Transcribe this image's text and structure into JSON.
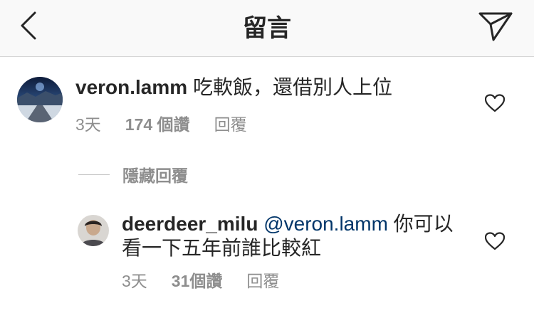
{
  "header": {
    "title": "留言",
    "back_icon": "chevron-left-icon",
    "send_icon": "paper-plane-icon"
  },
  "comments": [
    {
      "username": "veron.lamm",
      "text": "吃軟飯，還借別人上位",
      "time": "3天",
      "likes": "174 個讚",
      "reply": "回覆"
    }
  ],
  "hidden_replies_label": "隱藏回覆",
  "replies": [
    {
      "username": "deerdeer_milu",
      "mention": "@veron.lamm",
      "text_line1": "你可以",
      "text_line2": "看一下五年前誰比較紅",
      "time": "3天",
      "likes": "31個讚",
      "reply": "回覆"
    }
  ],
  "colors": {
    "text_primary": "#262626",
    "text_secondary": "#8e8e8e",
    "mention": "#003569",
    "header_bg": "#f9f9f9"
  }
}
